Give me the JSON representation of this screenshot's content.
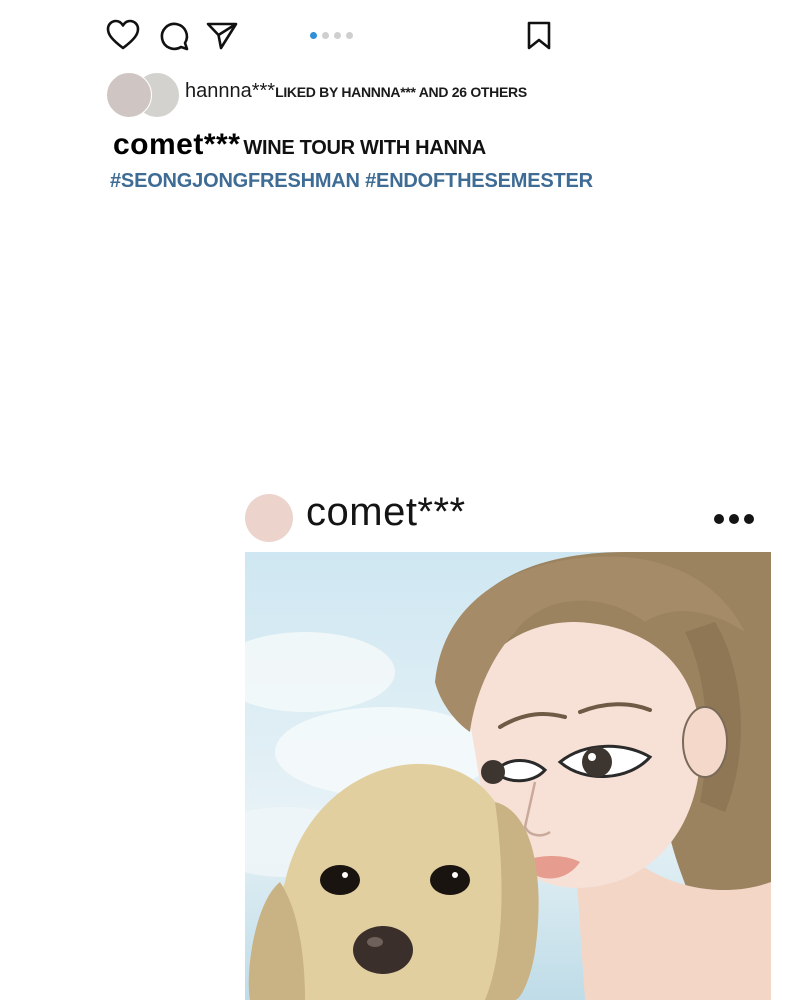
{
  "action_bar": {
    "icons": [
      "heart-icon",
      "comment-icon",
      "share-icon",
      "bookmark-icon"
    ],
    "carousel": {
      "count": 4,
      "active": 1,
      "active_color": "#2f8fd8",
      "inactive_color": "#cfcfcf"
    }
  },
  "likes": {
    "name": "hannna***",
    "text": "LIKED BY HANNNA*** AND 26 OTHERS"
  },
  "caption": {
    "username": "comet***",
    "text": "WINE TOUR WITH HANNA",
    "hashtags": "#SEONGJONGFRESHMAN #ENDOFTHESEMESTER",
    "hashtag_color": "#3f6c95"
  },
  "post": {
    "username": "comet***",
    "avatar_color": "#ecd3cc",
    "more_icon": "more-horizontal-icon",
    "image": "illustration-woman-with-golden-retriever"
  }
}
